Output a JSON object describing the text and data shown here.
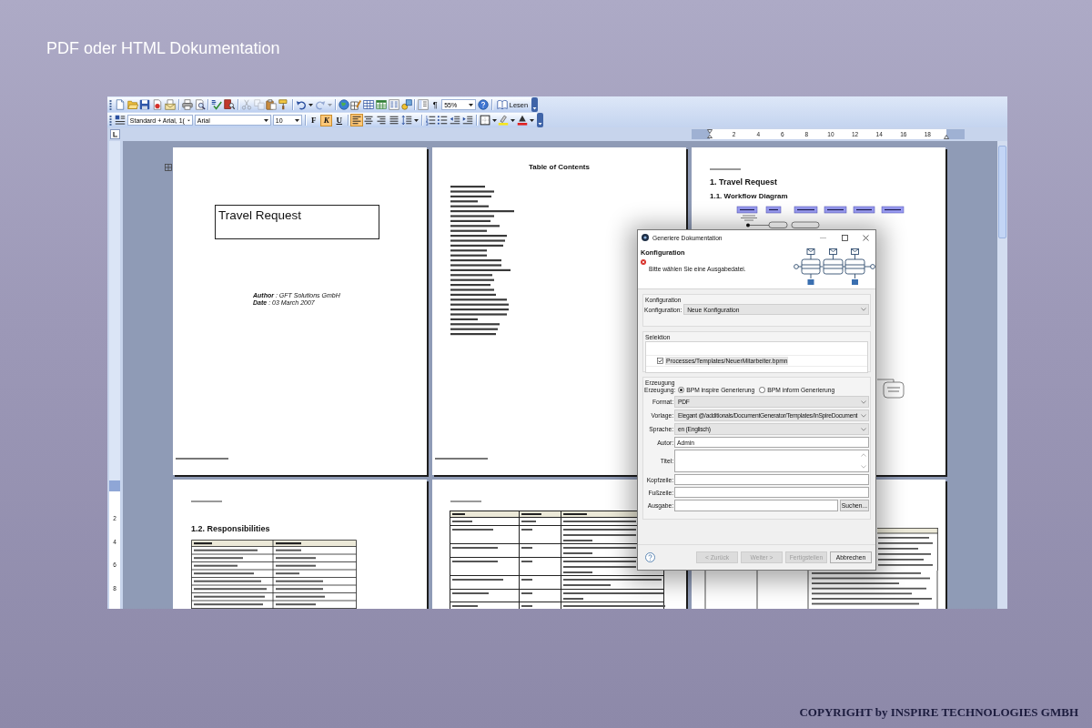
{
  "slide": {
    "title": "PDF oder HTML Dokumentation",
    "copyright": "COPYRIGHT by INSPIRE TECHNOLOGIES GMBH"
  },
  "standard_toolbar": {
    "groups": [
      [
        {
          "kind": "new",
          "disabled": false
        },
        {
          "kind": "open",
          "disabled": false
        },
        {
          "kind": "save",
          "disabled": false
        },
        {
          "kind": "permission",
          "disabled": false
        },
        {
          "kind": "mail",
          "disabled": false
        }
      ],
      [
        {
          "kind": "print",
          "disabled": false
        },
        {
          "kind": "preview",
          "disabled": false
        }
      ],
      [
        {
          "kind": "spelling",
          "disabled": false
        },
        {
          "kind": "research",
          "disabled": false
        }
      ],
      [
        {
          "kind": "cut",
          "disabled": true
        },
        {
          "kind": "copy",
          "disabled": true
        },
        {
          "kind": "paste",
          "disabled": false
        },
        {
          "kind": "painter",
          "disabled": false
        }
      ],
      [
        {
          "kind": "undo",
          "disabled": false
        },
        {
          "kind": "dropdown",
          "disabled": false
        },
        {
          "kind": "redo",
          "disabled": true
        },
        {
          "kind": "dropdown",
          "disabled": true
        }
      ],
      [
        {
          "kind": "hyperlink",
          "disabled": false
        },
        {
          "kind": "tables",
          "disabled": false
        },
        {
          "kind": "table",
          "disabled": false
        },
        {
          "kind": "sheet",
          "disabled": false
        },
        {
          "kind": "columns",
          "disabled": false
        },
        {
          "kind": "drawing",
          "disabled": false
        }
      ],
      [
        {
          "kind": "docmap",
          "disabled": false
        },
        {
          "kind": "text",
          "label": "¶",
          "disabled": false
        },
        {
          "kind": "combo",
          "value": "55%",
          "disabled": false
        },
        {
          "kind": "help",
          "disabled": false
        }
      ],
      [
        {
          "kind": "button",
          "label": "Lesen",
          "disabled": false
        }
      ]
    ]
  },
  "formatting_toolbar": {
    "groups": [
      [
        {
          "kind": "styles"
        },
        {
          "kind": "style_combo",
          "value": "Standard + Arial, 1("
        },
        {
          "kind": "font_combo",
          "value": "Arial"
        },
        {
          "kind": "size_combo",
          "value": "10"
        }
      ],
      [
        {
          "kind": "bold",
          "label": "F",
          "selected": false
        },
        {
          "kind": "italic",
          "label": "K",
          "selected": true
        },
        {
          "kind": "underline",
          "label": "U",
          "selected": false
        }
      ],
      [
        {
          "kind": "align_left",
          "selected": true
        },
        {
          "kind": "align_center",
          "selected": false
        },
        {
          "kind": "align_right",
          "selected": false
        },
        {
          "kind": "justify",
          "selected": false
        },
        {
          "kind": "line_spacing"
        },
        {
          "kind": "dropdown"
        }
      ],
      [
        {
          "kind": "numbering"
        },
        {
          "kind": "bullets"
        },
        {
          "kind": "outdent"
        },
        {
          "kind": "indent"
        }
      ],
      [
        {
          "kind": "border"
        },
        {
          "kind": "dropdown"
        },
        {
          "kind": "highlight"
        },
        {
          "kind": "dropdown"
        },
        {
          "kind": "font_color"
        },
        {
          "kind": "dropdown"
        }
      ]
    ]
  },
  "ruler": {
    "marks": [
      "2",
      "4",
      "6",
      "8",
      "10",
      "12",
      "14",
      "16",
      "18"
    ]
  },
  "vertical_ruler": {
    "marks": [
      "2",
      "4",
      "6",
      "8"
    ]
  },
  "pages": [
    {
      "kind": "title",
      "title": "Travel Request",
      "author": "**Author** : GFT Solutions GmbH",
      "date": "**Date** : 03 March 2007"
    },
    {
      "kind": "toc",
      "heading": "Table of Contents"
    },
    {
      "kind": "diagram",
      "heading": "1. Travel Request",
      "subheading": "1.1. Workflow Diagram"
    },
    {
      "kind": "responsibilities",
      "heading": "1.2. Responsibilities"
    },
    {
      "kind": "variables"
    },
    {
      "kind": "table_fragment"
    }
  ],
  "dialog": {
    "title": "Generiere Dokumentation",
    "header": {
      "title": "Konfiguration",
      "message": "Bitte wählen Sie eine Ausgabedatei."
    },
    "configuration": {
      "legend": "Konfiguration",
      "label": "Konfiguration:",
      "value": "Neue Konfiguration"
    },
    "selection": {
      "legend": "Selektion",
      "items": [
        {
          "label": "Processes/Templates/NeuerMitarbeiter.bpmn",
          "checked": true,
          "selected": true
        }
      ]
    },
    "generation": {
      "legend": "Erzeugung",
      "label": "Erzeugung:",
      "options": [
        {
          "label": "BPM inspire Generierung",
          "selected": true
        },
        {
          "label": "BPM inform Generierung",
          "selected": false
        }
      ],
      "fields": [
        {
          "kind": "combo",
          "label": "Format:",
          "value": "PDF"
        },
        {
          "kind": "combo",
          "label": "Vorlage:",
          "value": "Elegant @/additionals/DocumentGenerator/Templates/InSpireDocument"
        },
        {
          "kind": "combo",
          "label": "Sprache:",
          "value": "en (Englisch)"
        },
        {
          "kind": "text",
          "label": "Autor:",
          "value": "Admin"
        },
        {
          "kind": "textarea",
          "label": "Titel:"
        },
        {
          "kind": "text",
          "label": "Kopfzeile:"
        },
        {
          "kind": "text",
          "label": "Fußzeile:"
        },
        {
          "kind": "file",
          "label": "Ausgabe:",
          "button": "Suchen..."
        }
      ]
    },
    "buttons": [
      {
        "label": "< Zurück",
        "disabled": true
      },
      {
        "label": "Weiter >",
        "disabled": true
      },
      {
        "label": "Fertigstellen",
        "disabled": true
      },
      {
        "label": "Abbrechen",
        "disabled": false
      }
    ]
  }
}
